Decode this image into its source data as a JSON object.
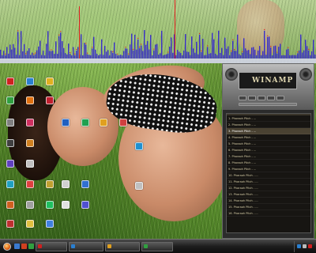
{
  "desktop": {
    "icons": [
      {
        "label": "",
        "color": "#d02020",
        "icon": "app-icon"
      },
      {
        "label": "",
        "color": "#2a7fd0",
        "icon": "app-icon"
      },
      {
        "label": "",
        "color": "#e0b020",
        "icon": "app-icon"
      },
      {
        "label": "",
        "color": "#30a040",
        "icon": "app-icon"
      },
      {
        "label": "",
        "color": "#e07010",
        "icon": "app-icon"
      },
      {
        "label": "",
        "color": "#c02030",
        "icon": "app-icon"
      },
      {
        "label": "",
        "color": "#2060c0",
        "icon": "app-icon"
      },
      {
        "label": "",
        "color": "#20a050",
        "icon": "app-icon"
      },
      {
        "label": "",
        "color": "#808080",
        "icon": "app-icon"
      },
      {
        "label": "",
        "color": "#d03060",
        "icon": "app-icon"
      },
      {
        "label": "",
        "color": "#404040",
        "icon": "app-icon"
      },
      {
        "label": "",
        "color": "#d08020",
        "icon": "app-icon"
      },
      {
        "label": "",
        "color": "#6040c0",
        "icon": "app-icon"
      },
      {
        "label": "",
        "color": "#c0c0c0",
        "icon": "app-icon"
      },
      {
        "label": "",
        "color": "#20a0c0",
        "icon": "app-icon"
      },
      {
        "label": "",
        "color": "#e04040",
        "icon": "app-icon"
      },
      {
        "label": "",
        "color": "#c0a030",
        "icon": "app-icon"
      },
      {
        "label": "",
        "color": "#d0d0d0",
        "icon": "app-icon"
      },
      {
        "label": "",
        "color": "#3070d0",
        "icon": "app-icon"
      },
      {
        "label": "",
        "color": "#d06020",
        "icon": "app-icon"
      },
      {
        "label": "",
        "color": "#a0a0a0",
        "icon": "app-icon"
      },
      {
        "label": "",
        "color": "#20c060",
        "icon": "app-icon"
      },
      {
        "label": "",
        "color": "#e0e0e0",
        "icon": "app-icon"
      },
      {
        "label": "",
        "color": "#5050d0",
        "icon": "app-icon"
      },
      {
        "label": "",
        "color": "#c03030",
        "icon": "app-icon"
      },
      {
        "label": "",
        "color": "#e0c040",
        "icon": "app-icon"
      },
      {
        "label": "",
        "color": "#4080e0",
        "icon": "app-icon"
      },
      {
        "label": "",
        "color": "#e0a020",
        "icon": "app-icon"
      },
      {
        "label": "",
        "color": "#d04040",
        "icon": "app-icon"
      },
      {
        "label": "",
        "color": "#2090d0",
        "icon": "app-icon"
      },
      {
        "label": "",
        "color": "#c0c0c0",
        "icon": "app-icon"
      }
    ]
  },
  "player": {
    "logo": "WINAMP",
    "playlist_header": [
      "",
      ""
    ],
    "tracks": [
      {
        "title": "1. Pharaoh Pitch - ...",
        "time": ""
      },
      {
        "title": "2. Pharaoh Pitch - ...",
        "time": ""
      },
      {
        "title": "3. Pharaoh Pitch - ...",
        "time": ""
      },
      {
        "title": "4. Pharaoh Pitch - ...",
        "time": ""
      },
      {
        "title": "5. Pharaoh Pitch - ...",
        "time": ""
      },
      {
        "title": "6. Pharaoh Pitch - ...",
        "time": ""
      },
      {
        "title": "7. Pharaoh Pitch - ...",
        "time": ""
      },
      {
        "title": "8. Pharaoh Pitch - ...",
        "time": ""
      },
      {
        "title": "9. Pharaoh Pitch - ...",
        "time": ""
      },
      {
        "title": "10. Pharaoh Pitch - ...",
        "time": ""
      },
      {
        "title": "11. Pharaoh Pitch - ...",
        "time": ""
      },
      {
        "title": "12. Pharaoh Pitch - ...",
        "time": ""
      },
      {
        "title": "13. Pharaoh Pitch - ...",
        "time": ""
      },
      {
        "title": "14. Pharaoh Pitch - ...",
        "time": ""
      },
      {
        "title": "15. Pharaoh Pitch - ...",
        "time": ""
      },
      {
        "title": "16. Pharaoh Pitch - ...",
        "time": ""
      }
    ],
    "selected_index": 2
  },
  "taskbar": {
    "start_label": "",
    "tasks": [
      {
        "label": "",
        "color": "#d02020"
      },
      {
        "label": "",
        "color": "#2a7fd0"
      },
      {
        "label": "",
        "color": "#e0a020"
      },
      {
        "label": "",
        "color": "#30a040"
      }
    ],
    "clock": {
      "time": "",
      "date": ""
    }
  },
  "colors": {
    "analyzer_bar": "#3a2fc8",
    "analyzer_peak": "#e02020",
    "taskbar": "#1e1e1e"
  }
}
